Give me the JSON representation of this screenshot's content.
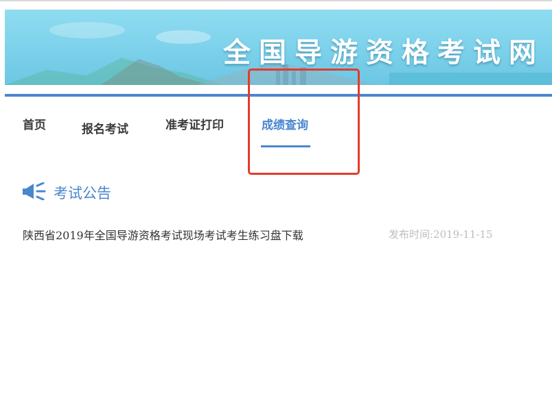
{
  "banner": {
    "title": "全国导游资格考试网"
  },
  "nav": {
    "items": [
      {
        "label": "首页"
      },
      {
        "label": "报名考试"
      },
      {
        "label": "准考证打印"
      },
      {
        "label": "成绩查询",
        "active": true
      }
    ]
  },
  "notices": {
    "heading": "考试公告",
    "icon": "megaphone-icon",
    "items": [
      {
        "title": "陕西省2019年全国导游资格考试现场考试考生练习盘下载",
        "date": "发布时间:2019-11-15"
      }
    ]
  },
  "colors": {
    "accent": "#4a86cf",
    "highlight": "#e53a2c",
    "banner_sky": "#8fdcf0",
    "muted_text": "#bdbdbd"
  }
}
